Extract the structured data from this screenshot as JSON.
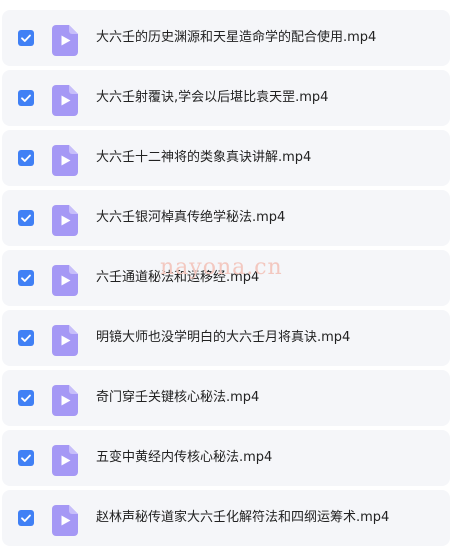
{
  "files": [
    {
      "name": "大六壬的历史渊源和天星造命学的配合使用.mp4",
      "checked": true,
      "icon": "video-file-icon"
    },
    {
      "name": "大六壬射覆诀,学会以后堪比袁天罡.mp4",
      "checked": true,
      "icon": "video-file-icon"
    },
    {
      "name": "大六壬十二神将的类象真诀讲解.mp4",
      "checked": true,
      "icon": "video-file-icon"
    },
    {
      "name": "大六壬银河棹真传绝学秘法.mp4",
      "checked": true,
      "icon": "video-file-icon"
    },
    {
      "name": "六壬通道秘法和运移经.mp4",
      "checked": true,
      "icon": "video-file-icon"
    },
    {
      "name": "明镜大师也没学明白的大六壬月将真诀.mp4",
      "checked": true,
      "icon": "video-file-icon"
    },
    {
      "name": "奇门穿壬关键核心秘法.mp4",
      "checked": true,
      "icon": "video-file-icon"
    },
    {
      "name": "五变中黄经内传核心秘法.mp4",
      "checked": true,
      "icon": "video-file-icon"
    },
    {
      "name": "赵林声秘传道家大六壬化解符法和四纲运筹术.mp4",
      "checked": true,
      "icon": "video-file-icon"
    }
  ],
  "watermark": "nayona.cn",
  "colors": {
    "checkbox": "#4080f5",
    "file_icon": "#a598f5",
    "row_bg": "#f5f6f9"
  }
}
